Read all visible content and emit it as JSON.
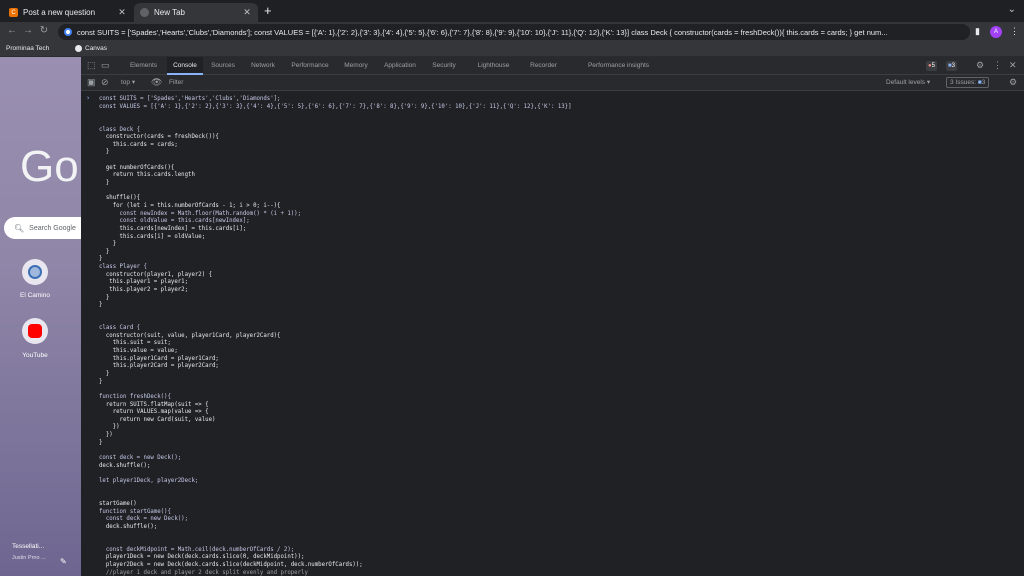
{
  "browser": {
    "tabs": [
      {
        "title": "Post a new question",
        "icon": "chegg-icon",
        "active": false
      },
      {
        "title": "New Tab",
        "icon": "chrome-icon",
        "active": true
      }
    ],
    "address": "const SUITS = ['Spades','Hearts','Clubs','Diamonds']; const VALUES = [{'A': 1},{'2': 2},{'3': 3},{'4': 4},{'5': 5},{'6': 6},{'7': 7},{'8': 8},{'9': 9},{'10': 10},{'J': 11},{'Q': 12},{'K': 13}] class Deck { constructor(cards = freshDeck()){ this.cards = cards; } get num...",
    "avatar_letter": "A",
    "bookmarks": [
      "Prominaa Tech",
      "Canvas"
    ]
  },
  "ntp": {
    "logo": "Go",
    "search_placeholder": "Search Google",
    "shortcuts": [
      {
        "label": "El Camino",
        "color": "#3b6fb6"
      },
      {
        "label": "YouTube",
        "color": "#ff0000"
      }
    ],
    "profile_name": "Tessellati...",
    "profile_sub": "Justin Prno ..."
  },
  "devtools": {
    "tabs": [
      "Elements",
      "Console",
      "Sources",
      "Network",
      "Performance",
      "Memory",
      "Application",
      "Security",
      "Lighthouse",
      "Recorder",
      "Performance insights"
    ],
    "active_tab": "Console",
    "errors": "5",
    "warnings": "3",
    "context": "top",
    "filter_placeholder": "Filter",
    "levels": "Default levels",
    "issues": "3 Issues:",
    "issues_count": "3"
  },
  "console_lines": [
    "const SUITS = ['Spades','Hearts','Clubs','Diamonds'];",
    "const VALUES = [{'A': 1},{'2': 2},{'3': 3},{'4': 4},{'5': 5},{'6': 6},{'7': 7},{'8': 8},{'9': 9},{'10': 10},{'J': 11},{'Q': 12},{'K': 13}]",
    "",
    "",
    "class Deck {",
    "  constructor(cards = freshDeck()){",
    "    this.cards = cards;",
    "  }",
    "",
    "  get numberOfCards(){",
    "    return this.cards.length",
    "  }",
    "",
    "  shuffle(){",
    "    for (let i = this.numberOfCards - 1; i > 0; i--){",
    "      const newIndex = Math.floor(Math.random() * (i + 1));",
    "      const oldValue = this.cards[newIndex];",
    "      this.cards[newIndex] = this.cards[i];",
    "      this.cards[i] = oldValue;",
    "    }",
    "  }",
    "}",
    "class Player {",
    "  constructor(player1, player2) {",
    "   this.player1 = player1;",
    "   this.player2 = player2;",
    "  }",
    "}",
    "",
    "",
    "class Card {",
    "  constructor(suit, value, player1Card, player2Card){",
    "    this.suit = suit;",
    "    this.value = value;",
    "    this.player1Card = player1Card;",
    "    this.player2Card = player2Card;",
    "  }",
    "}",
    "",
    "function freshDeck(){",
    "  return SUITS.flatMap(suit => {",
    "    return VALUES.map(value => {",
    "      return new Card(suit, value)",
    "    })",
    "  })",
    "}",
    "",
    "const deck = new Deck();",
    "deck.shuffle();",
    "",
    "let player1Deck, player2Deck;",
    "",
    "",
    "startGame()",
    "function startGame(){",
    "  const deck = new Deck();",
    "  deck.shuffle();",
    "",
    "",
    "  const deckMidpoint = Math.ceil(deck.numberOfCards / 2);",
    "  player1Deck = new Deck(deck.cards.slice(0, deckMidpoint));",
    "  player2Deck = new Deck(deck.cards.slice(deckMidpoint, deck.numberOfCards));",
    "  //player 1 deck and player 2 deck split evenly and properly"
  ]
}
